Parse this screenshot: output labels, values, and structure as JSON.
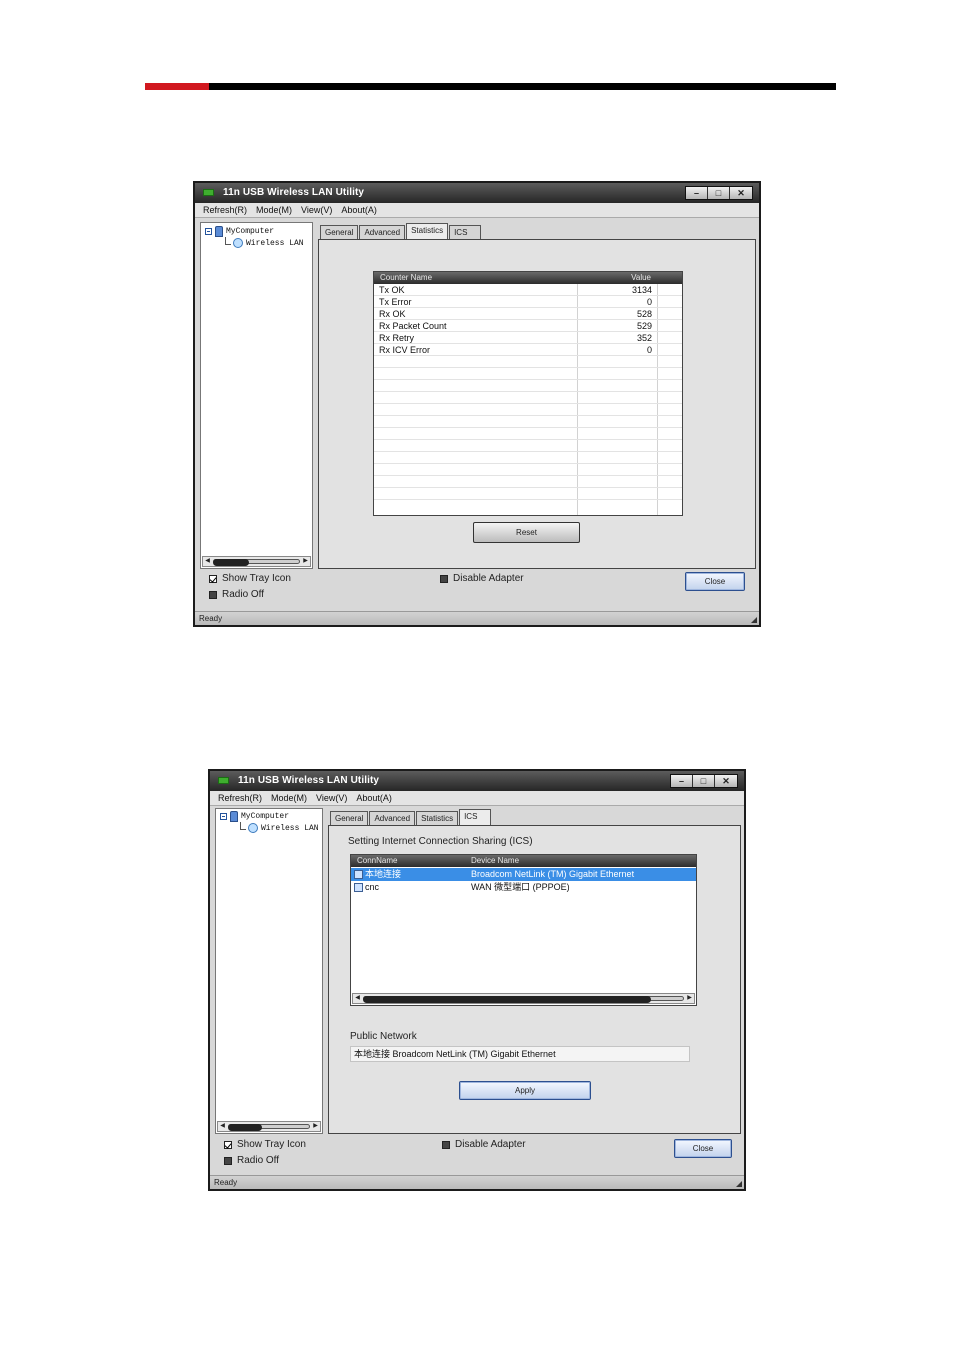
{
  "windows": [
    {
      "title": "11n USB Wireless LAN Utility",
      "menu": [
        "Refresh(R)",
        "Mode(M)",
        "View(V)",
        "About(A)"
      ],
      "tree": {
        "root": "MyComputer",
        "child": "Wireless LAN"
      },
      "tabs": [
        "General",
        "Advanced",
        "Statistics",
        "ICS"
      ],
      "active_tab": "Statistics",
      "stats_table": {
        "columns": [
          "Counter Name",
          "Value"
        ],
        "rows": [
          {
            "name": "Tx OK",
            "value": "3134"
          },
          {
            "name": "Tx Error",
            "value": "0"
          },
          {
            "name": "Rx OK",
            "value": "528"
          },
          {
            "name": "Rx Packet Count",
            "value": "529"
          },
          {
            "name": "Rx Retry",
            "value": "352"
          },
          {
            "name": "Rx ICV Error",
            "value": "0"
          }
        ]
      },
      "reset_label": "Reset",
      "show_tray_icon": "Show Tray Icon",
      "radio_off": "Radio Off",
      "disable_adapter": "Disable Adapter",
      "close_label": "Close",
      "status": "Ready"
    },
    {
      "title": "11n USB Wireless LAN Utility",
      "menu": [
        "Refresh(R)",
        "Mode(M)",
        "View(V)",
        "About(A)"
      ],
      "tree": {
        "root": "MyComputer",
        "child": "Wireless LAN"
      },
      "tabs": [
        "General",
        "Advanced",
        "Statistics",
        "ICS"
      ],
      "active_tab": "ICS",
      "ics_heading": "Setting Internet Connection Sharing (ICS)",
      "ics_table": {
        "columns": [
          "ConnName",
          "Device Name"
        ],
        "rows": [
          {
            "conn": "本地连接",
            "device": "Broadcom NetLink (TM) Gigabit Ethernet",
            "selected": true
          },
          {
            "conn": "cnc",
            "device": "WAN 微型端口 (PPPOE)",
            "selected": false
          }
        ]
      },
      "public_network_label": "Public Network",
      "public_network_value": "本地连接 Broadcom NetLink (TM) Gigabit Ethernet",
      "apply_label": "Apply",
      "show_tray_icon": "Show Tray Icon",
      "radio_off": "Radio Off",
      "disable_adapter": "Disable Adapter",
      "close_label": "Close",
      "status": "Ready"
    }
  ],
  "colors": {
    "accent_red": "#d1181f",
    "rule_black": "#000000",
    "selection_blue": "#3a8ee6"
  }
}
